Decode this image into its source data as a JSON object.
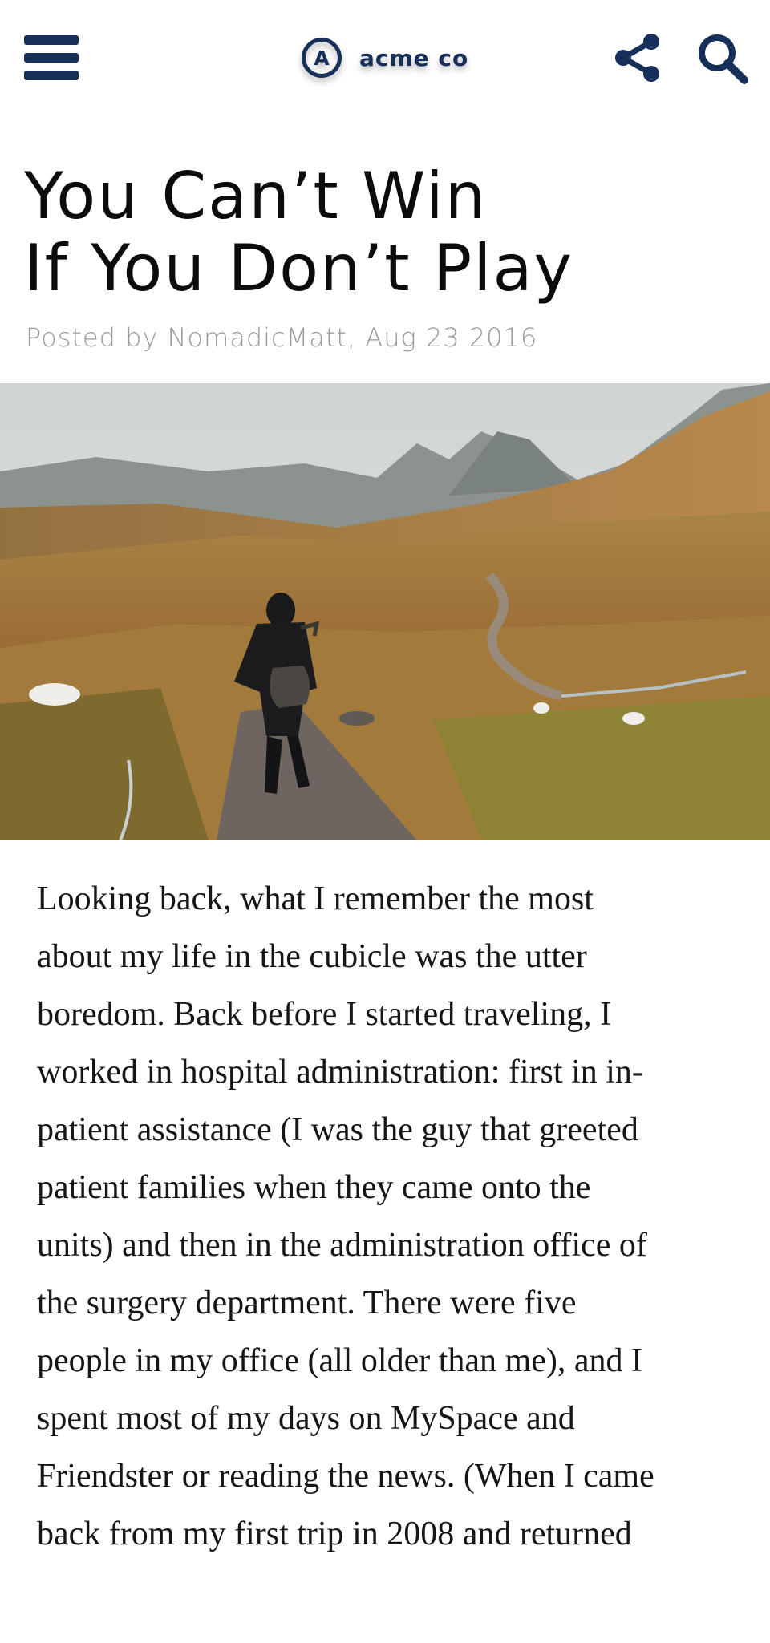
{
  "header": {
    "menu_icon": "hamburger-menu-icon",
    "logo": {
      "mark": "A",
      "name": "acme co"
    },
    "share_icon": "share-icon",
    "search_icon": "search-icon",
    "brand_color": "#17305a"
  },
  "post": {
    "title_line1": "You Can’t Win",
    "title_line2": "If You Don’t Play",
    "meta": "Posted by NomadicMatt, Aug 23 2016",
    "hero_image": "photo of a hiker with a backpack walking a gravel path through a mountain valley with sheep"
  },
  "article": {
    "lines": [
      "Looking back, what I remember the most",
      "about my life in the cubicle was the utter",
      "boredom. Back before I started traveling, I",
      "worked in hospital administration: first in in-",
      "patient assistance (I was the guy that greeted",
      "patient families when they came onto the",
      "units) and then in the administration office of",
      "the surgery department. There were five",
      "people in my office (all older than me), and I",
      "spent most of my days on MySpace and",
      "Friendster or reading the news. (When I came",
      "back from my first trip in 2008 and returned"
    ]
  }
}
